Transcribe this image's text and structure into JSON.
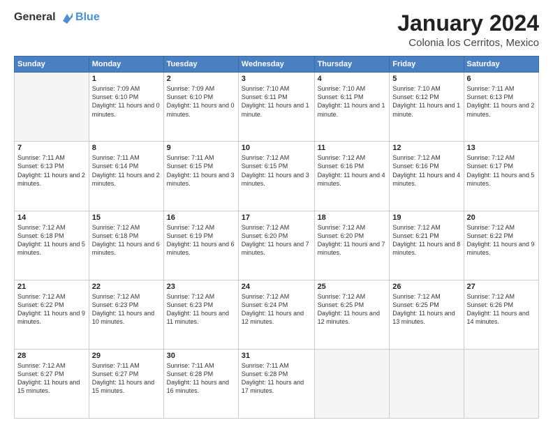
{
  "logo": {
    "general": "General",
    "blue": "Blue"
  },
  "header": {
    "month": "January 2024",
    "location": "Colonia los Cerritos, Mexico"
  },
  "weekdays": [
    "Sunday",
    "Monday",
    "Tuesday",
    "Wednesday",
    "Thursday",
    "Friday",
    "Saturday"
  ],
  "weeks": [
    [
      {
        "day": "",
        "empty": true
      },
      {
        "day": "1",
        "sunrise": "Sunrise: 7:09 AM",
        "sunset": "Sunset: 6:10 PM",
        "daylight": "Daylight: 11 hours and 0 minutes."
      },
      {
        "day": "2",
        "sunrise": "Sunrise: 7:09 AM",
        "sunset": "Sunset: 6:10 PM",
        "daylight": "Daylight: 11 hours and 0 minutes."
      },
      {
        "day": "3",
        "sunrise": "Sunrise: 7:10 AM",
        "sunset": "Sunset: 6:11 PM",
        "daylight": "Daylight: 11 hours and 1 minute."
      },
      {
        "day": "4",
        "sunrise": "Sunrise: 7:10 AM",
        "sunset": "Sunset: 6:11 PM",
        "daylight": "Daylight: 11 hours and 1 minute."
      },
      {
        "day": "5",
        "sunrise": "Sunrise: 7:10 AM",
        "sunset": "Sunset: 6:12 PM",
        "daylight": "Daylight: 11 hours and 1 minute."
      },
      {
        "day": "6",
        "sunrise": "Sunrise: 7:11 AM",
        "sunset": "Sunset: 6:13 PM",
        "daylight": "Daylight: 11 hours and 2 minutes."
      }
    ],
    [
      {
        "day": "7",
        "sunrise": "Sunrise: 7:11 AM",
        "sunset": "Sunset: 6:13 PM",
        "daylight": "Daylight: 11 hours and 2 minutes."
      },
      {
        "day": "8",
        "sunrise": "Sunrise: 7:11 AM",
        "sunset": "Sunset: 6:14 PM",
        "daylight": "Daylight: 11 hours and 2 minutes."
      },
      {
        "day": "9",
        "sunrise": "Sunrise: 7:11 AM",
        "sunset": "Sunset: 6:15 PM",
        "daylight": "Daylight: 11 hours and 3 minutes."
      },
      {
        "day": "10",
        "sunrise": "Sunrise: 7:12 AM",
        "sunset": "Sunset: 6:15 PM",
        "daylight": "Daylight: 11 hours and 3 minutes."
      },
      {
        "day": "11",
        "sunrise": "Sunrise: 7:12 AM",
        "sunset": "Sunset: 6:16 PM",
        "daylight": "Daylight: 11 hours and 4 minutes."
      },
      {
        "day": "12",
        "sunrise": "Sunrise: 7:12 AM",
        "sunset": "Sunset: 6:16 PM",
        "daylight": "Daylight: 11 hours and 4 minutes."
      },
      {
        "day": "13",
        "sunrise": "Sunrise: 7:12 AM",
        "sunset": "Sunset: 6:17 PM",
        "daylight": "Daylight: 11 hours and 5 minutes."
      }
    ],
    [
      {
        "day": "14",
        "sunrise": "Sunrise: 7:12 AM",
        "sunset": "Sunset: 6:18 PM",
        "daylight": "Daylight: 11 hours and 5 minutes."
      },
      {
        "day": "15",
        "sunrise": "Sunrise: 7:12 AM",
        "sunset": "Sunset: 6:18 PM",
        "daylight": "Daylight: 11 hours and 6 minutes."
      },
      {
        "day": "16",
        "sunrise": "Sunrise: 7:12 AM",
        "sunset": "Sunset: 6:19 PM",
        "daylight": "Daylight: 11 hours and 6 minutes."
      },
      {
        "day": "17",
        "sunrise": "Sunrise: 7:12 AM",
        "sunset": "Sunset: 6:20 PM",
        "daylight": "Daylight: 11 hours and 7 minutes."
      },
      {
        "day": "18",
        "sunrise": "Sunrise: 7:12 AM",
        "sunset": "Sunset: 6:20 PM",
        "daylight": "Daylight: 11 hours and 7 minutes."
      },
      {
        "day": "19",
        "sunrise": "Sunrise: 7:12 AM",
        "sunset": "Sunset: 6:21 PM",
        "daylight": "Daylight: 11 hours and 8 minutes."
      },
      {
        "day": "20",
        "sunrise": "Sunrise: 7:12 AM",
        "sunset": "Sunset: 6:22 PM",
        "daylight": "Daylight: 11 hours and 9 minutes."
      }
    ],
    [
      {
        "day": "21",
        "sunrise": "Sunrise: 7:12 AM",
        "sunset": "Sunset: 6:22 PM",
        "daylight": "Daylight: 11 hours and 9 minutes."
      },
      {
        "day": "22",
        "sunrise": "Sunrise: 7:12 AM",
        "sunset": "Sunset: 6:23 PM",
        "daylight": "Daylight: 11 hours and 10 minutes."
      },
      {
        "day": "23",
        "sunrise": "Sunrise: 7:12 AM",
        "sunset": "Sunset: 6:23 PM",
        "daylight": "Daylight: 11 hours and 11 minutes."
      },
      {
        "day": "24",
        "sunrise": "Sunrise: 7:12 AM",
        "sunset": "Sunset: 6:24 PM",
        "daylight": "Daylight: 11 hours and 12 minutes."
      },
      {
        "day": "25",
        "sunrise": "Sunrise: 7:12 AM",
        "sunset": "Sunset: 6:25 PM",
        "daylight": "Daylight: 11 hours and 12 minutes."
      },
      {
        "day": "26",
        "sunrise": "Sunrise: 7:12 AM",
        "sunset": "Sunset: 6:25 PM",
        "daylight": "Daylight: 11 hours and 13 minutes."
      },
      {
        "day": "27",
        "sunrise": "Sunrise: 7:12 AM",
        "sunset": "Sunset: 6:26 PM",
        "daylight": "Daylight: 11 hours and 14 minutes."
      }
    ],
    [
      {
        "day": "28",
        "sunrise": "Sunrise: 7:12 AM",
        "sunset": "Sunset: 6:27 PM",
        "daylight": "Daylight: 11 hours and 15 minutes."
      },
      {
        "day": "29",
        "sunrise": "Sunrise: 7:11 AM",
        "sunset": "Sunset: 6:27 PM",
        "daylight": "Daylight: 11 hours and 15 minutes."
      },
      {
        "day": "30",
        "sunrise": "Sunrise: 7:11 AM",
        "sunset": "Sunset: 6:28 PM",
        "daylight": "Daylight: 11 hours and 16 minutes."
      },
      {
        "day": "31",
        "sunrise": "Sunrise: 7:11 AM",
        "sunset": "Sunset: 6:28 PM",
        "daylight": "Daylight: 11 hours and 17 minutes."
      },
      {
        "day": "",
        "empty": true
      },
      {
        "day": "",
        "empty": true
      },
      {
        "day": "",
        "empty": true
      }
    ]
  ]
}
